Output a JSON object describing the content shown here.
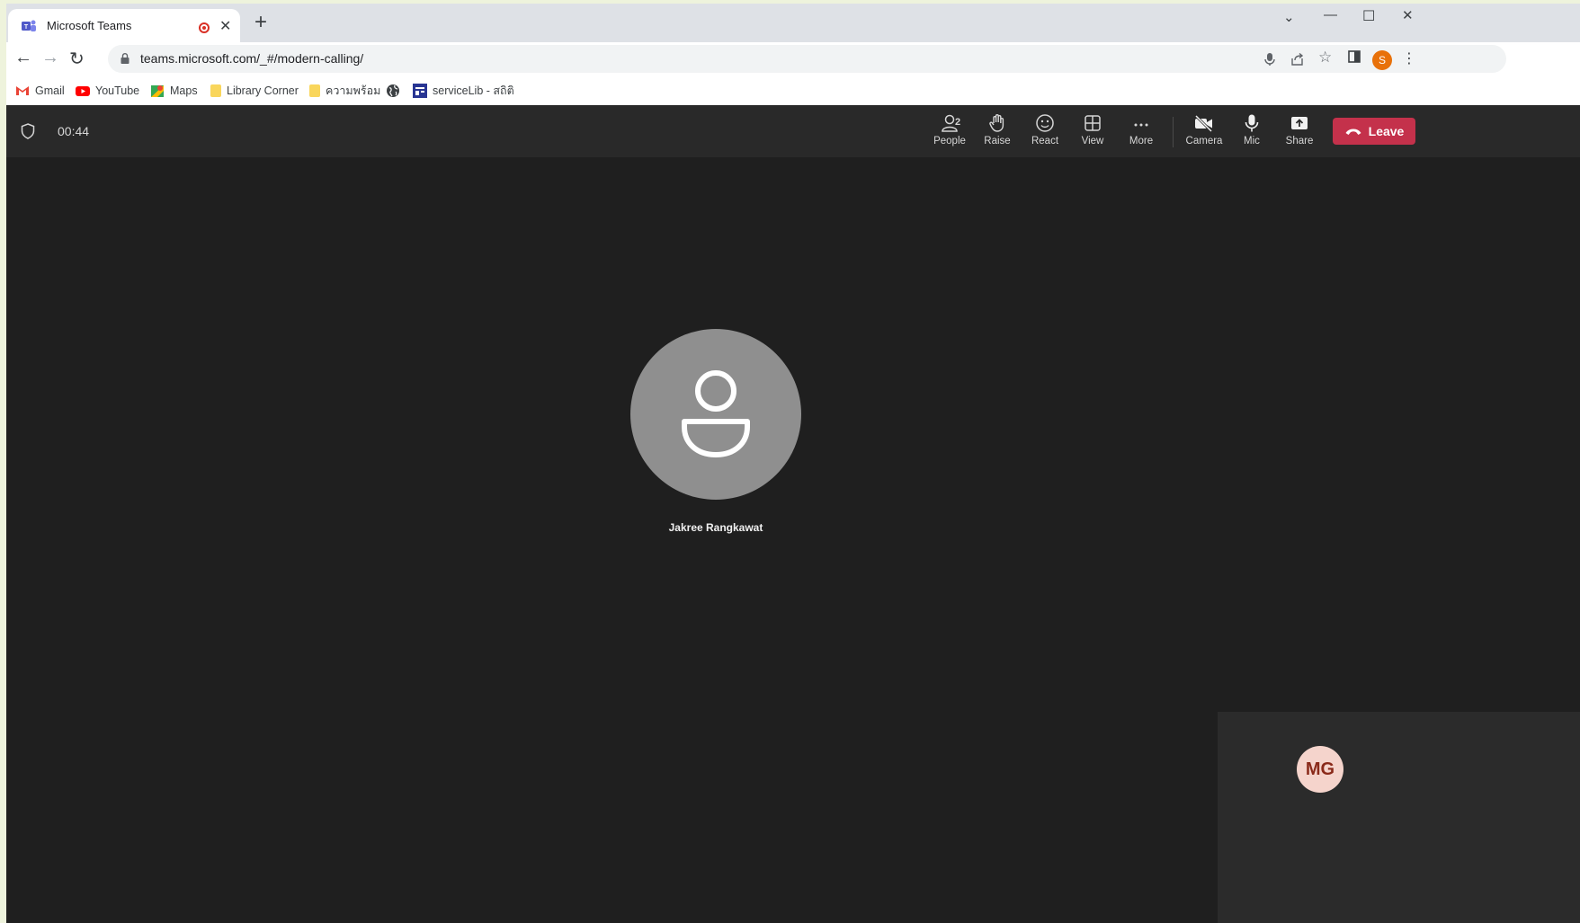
{
  "browser": {
    "tab": {
      "title": "Microsoft Teams"
    },
    "url": "teams.microsoft.com/_#/modern-calling/",
    "profile_initial": "S",
    "bookmarks": [
      {
        "label": "Gmail",
        "icon": "gmail-icon"
      },
      {
        "label": "YouTube",
        "icon": "youtube-icon"
      },
      {
        "label": "Maps",
        "icon": "maps-icon"
      },
      {
        "label": "Library Corner",
        "icon": "folder-icon"
      },
      {
        "label": "ความพร้อม",
        "icon": "folder-icon"
      },
      {
        "label": "",
        "icon": "globe-icon"
      },
      {
        "label": "serviceLib - สถิติ",
        "icon": "servicelib-icon"
      }
    ]
  },
  "meeting": {
    "timer": "00:44",
    "people_count": "2",
    "controls": {
      "people": "People",
      "raise": "Raise",
      "react": "React",
      "view": "View",
      "more": "More",
      "camera": "Camera",
      "mic": "Mic",
      "share": "Share"
    },
    "leave_label": "Leave",
    "participant": {
      "name": "Jakree Rangkawat"
    },
    "self": {
      "initials": "MG"
    }
  },
  "colors": {
    "leave": "#c4314b",
    "stage": "#1f1f1f",
    "toolbar": "#292929",
    "self_avatar_bg": "#f5d4cc"
  }
}
